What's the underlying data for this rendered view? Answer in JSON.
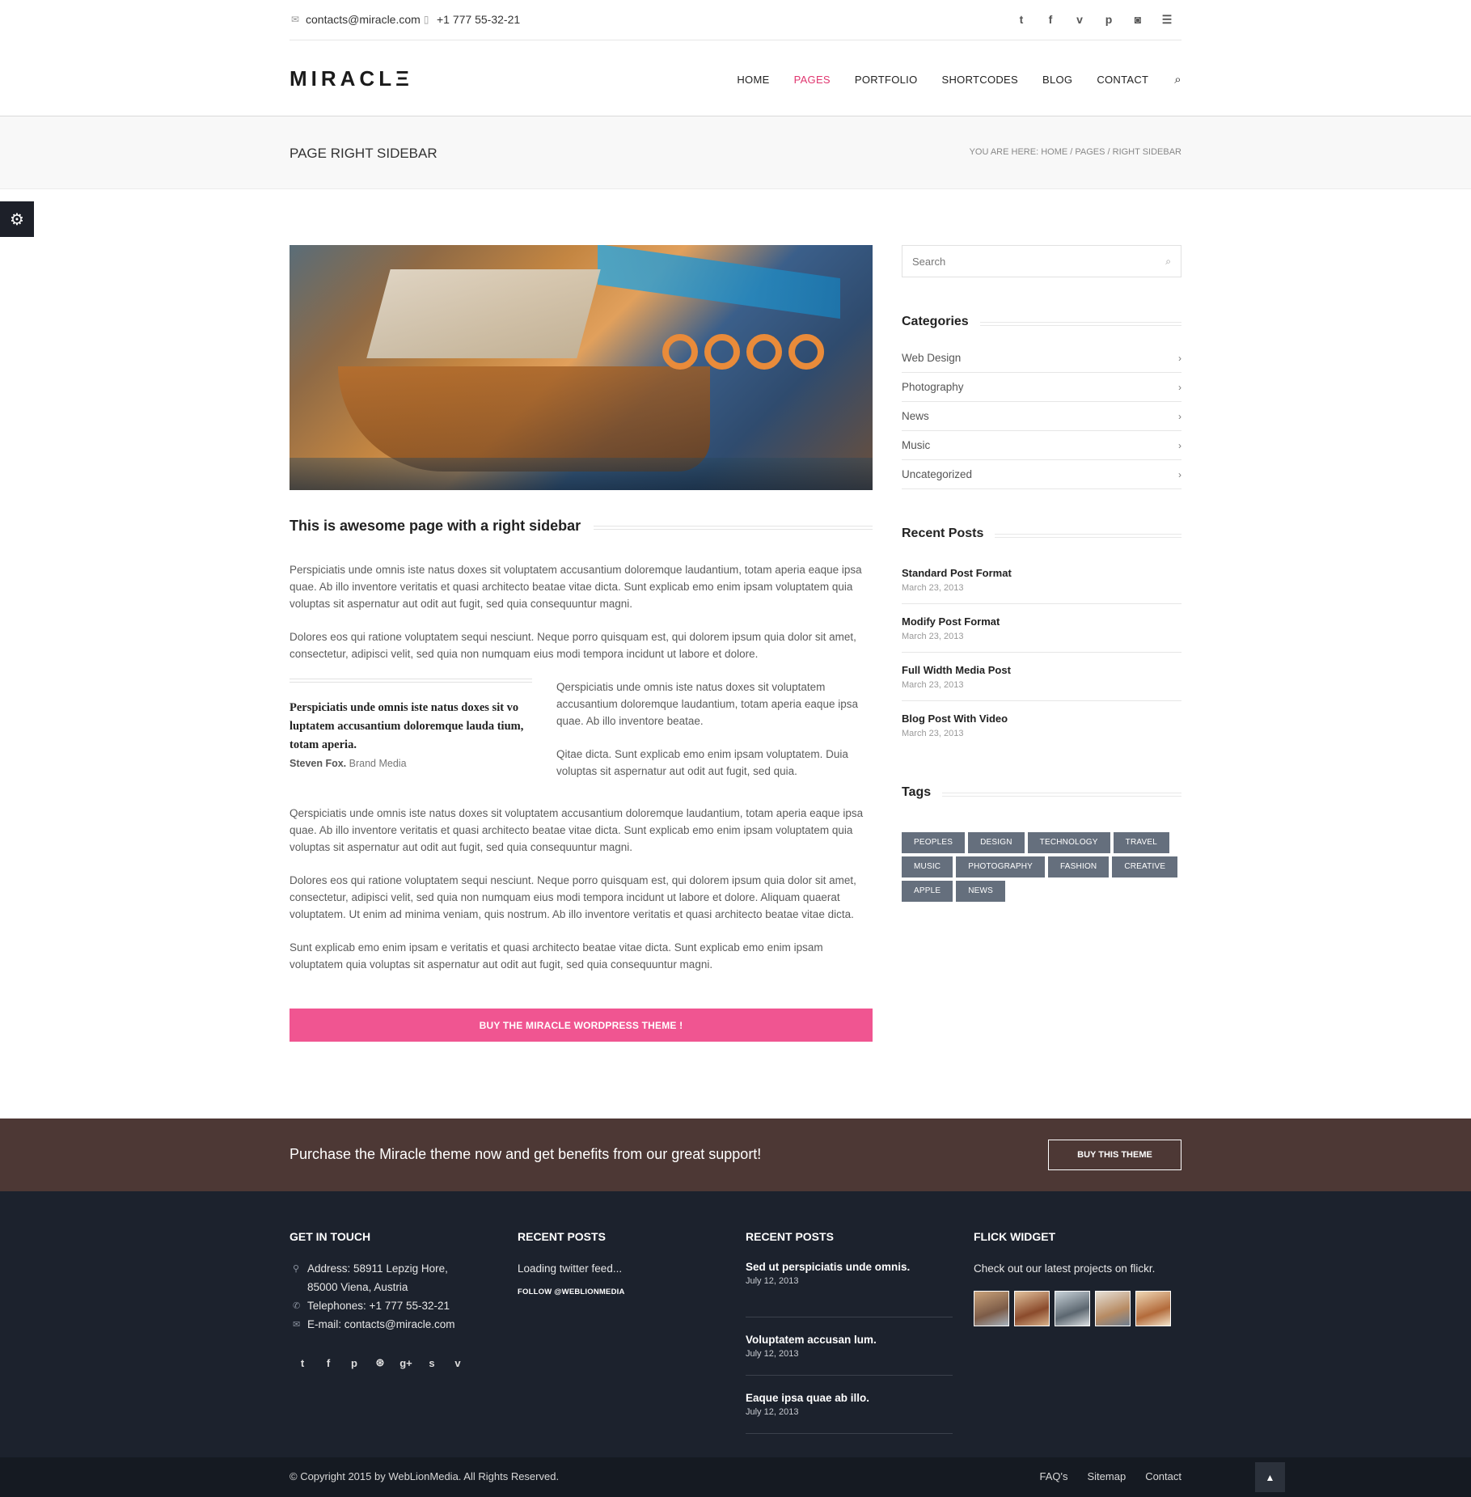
{
  "topbar": {
    "email": "contacts@miracle.com",
    "phone": "+1 777 55-32-21",
    "social": [
      "twitter-icon",
      "facebook-icon",
      "vimeo-icon",
      "pinterest-icon",
      "instagram-icon",
      "menu-icon"
    ]
  },
  "header": {
    "logo": "MIRACLΞ",
    "nav": [
      {
        "label": "HOME",
        "active": false
      },
      {
        "label": "PAGES",
        "active": true
      },
      {
        "label": "PORTFOLIO",
        "active": false
      },
      {
        "label": "SHORTCODES",
        "active": false
      },
      {
        "label": "BLOG",
        "active": false
      },
      {
        "label": "CONTACT",
        "active": false
      }
    ]
  },
  "titleband": {
    "title": "PAGE RIGHT SIDEBAR",
    "breadcrumb": "YOU ARE HERE: HOME / PAGES / RIGHT SIDEBAR"
  },
  "main": {
    "heading": "This is awesome page with a right sidebar",
    "p1": "Perspiciatis unde omnis iste natus doxes sit voluptatem accusantium doloremque laudantium, totam aperia eaque ipsa quae. Ab illo inventore veritatis et quasi architecto beatae vitae dicta. Sunt explicab emo enim ipsam voluptatem quia voluptas sit aspernatur aut odit aut fugit, sed quia consequuntur magni.",
    "p2": "Dolores eos qui ratione voluptatem sequi nesciunt. Neque porro quisquam est, qui dolorem ipsum quia dolor sit amet, consectetur, adipisci velit, sed quia non numquam eius modi tempora incidunt ut labore et dolore.",
    "quote": "Perspiciatis unde omnis iste natus doxes sit vo luptatem accusantium doloremque lauda tium, totam aperia.",
    "quote_author": "Steven Fox.",
    "quote_company": "Brand Media",
    "side_p1": "Qerspiciatis unde omnis iste natus doxes sit voluptatem accusantium doloremque laudantium, totam aperia eaque ipsa quae. Ab illo inventore beatae.",
    "side_p2": "Qitae dicta. Sunt explicab emo enim ipsam voluptatem. Duia voluptas sit aspernatur aut odit aut fugit, sed quia.",
    "p3": "Qerspiciatis unde omnis iste natus doxes sit voluptatem accusantium doloremque laudantium, totam aperia eaque ipsa quae. Ab illo inventore veritatis et quasi architecto beatae vitae dicta. Sunt explicab emo enim ipsam voluptatem quia voluptas sit aspernatur aut odit aut fugit, sed quia consequuntur magni.",
    "p4": "Dolores eos qui ratione voluptatem sequi nesciunt. Neque porro quisquam est, qui dolorem ipsum quia dolor sit amet, consectetur, adipisci velit, sed quia non numquam eius modi tempora incidunt ut labore et dolore. Aliquam quaerat voluptatem. Ut enim ad minima veniam, quis nostrum. Ab illo inventore veritatis et quasi architecto beatae vitae dicta.",
    "p5": "Sunt explicab emo enim ipsam e veritatis et quasi architecto beatae vitae dicta. Sunt explicab emo enim ipsam voluptatem quia voluptas sit aspernatur aut odit aut fugit, sed quia consequuntur magni.",
    "buy_button": "BUY THE MIRACLE WORDPRESS THEME !"
  },
  "sidebar": {
    "search_placeholder": "Search",
    "categories_title": "Categories",
    "categories": [
      "Web Design",
      "Photography",
      "News",
      "Music",
      "Uncategorized"
    ],
    "recent_title": "Recent Posts",
    "recent": [
      {
        "title": "Standard Post Format",
        "date": "March 23, 2013"
      },
      {
        "title": "Modify Post Format",
        "date": "March 23, 2013"
      },
      {
        "title": "Full Width Media Post",
        "date": "March 23, 2013"
      },
      {
        "title": "Blog Post With Video",
        "date": "March 23, 2013"
      }
    ],
    "tags_title": "Tags",
    "tags": [
      "PEOPLES",
      "DESIGN",
      "TECHNOLOGY",
      "TRAVEL",
      "MUSIC",
      "PHOTOGRAPHY",
      "FASHION",
      "CREATIVE",
      "APPLE",
      "NEWS"
    ]
  },
  "promo": {
    "text": "Purchase the Miracle theme now and get benefits from our great support!",
    "button": "BUY THIS THEME",
    "color": "#4d3835"
  },
  "footer": {
    "col1": {
      "title": "GET IN TOUCH",
      "address": "Address: 58911 Lepzig Hore, 85000 Viena, Austria",
      "phone": "Telephones: +1 777 55-32-21",
      "email": "E-mail: contacts@miracle.com",
      "social": [
        "twitter-icon",
        "facebook-icon",
        "pinterest-icon",
        "dribbble-icon",
        "google-plus-icon",
        "skype-icon",
        "vimeo-icon"
      ]
    },
    "col2": {
      "title": "RECENT POSTS",
      "feed": "Loading twitter feed...",
      "follow": "FOLLOW @WEBLIONMEDIA"
    },
    "col3": {
      "title": "RECENT POSTS",
      "posts": [
        {
          "title": "Sed ut perspiciatis unde omnis.",
          "date": "July 12, 2013"
        },
        {
          "title": "Voluptatem accusan lum.",
          "date": "July 12, 2013"
        },
        {
          "title": "Eaque ipsa quae ab illo.",
          "date": "July 12, 2013"
        }
      ]
    },
    "col4": {
      "title": "FLICK WIDGET",
      "text": "Check out our latest projects on flickr."
    },
    "copyright": "© Copyright 2015 by WebLionMedia. All Rights Reserved.",
    "links": [
      "FAQ's",
      "Sitemap",
      "Contact"
    ]
  },
  "colors": {
    "accent": "#e0366f",
    "button": "#f05591",
    "footer": "#1c222d",
    "tag": "#656f7d"
  }
}
